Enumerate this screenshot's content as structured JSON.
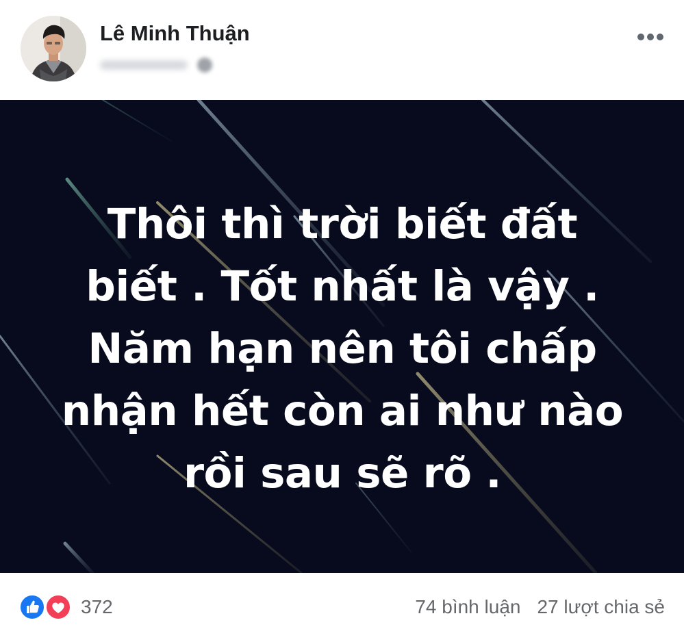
{
  "post": {
    "author": "Lê Minh Thuận",
    "meta_timestamp": "",
    "quote": "Thôi thì trời biết đất\nbiết . Tốt nhất là vậy .\nNăm hạn nên tôi chấp\nnhận hết còn ai như nào\nrồi sau sẽ rõ ."
  },
  "reactions": {
    "icons": [
      "like-icon",
      "love-icon"
    ],
    "count": "372"
  },
  "stats": {
    "comments": "74 bình luận",
    "shares": "27 lượt chia sẻ"
  },
  "colors": {
    "image_background": "#070b1d",
    "like": "#1877f2",
    "love": "#f33e58",
    "secondary_text": "#65676b",
    "name_text": "#1c1e21"
  },
  "icons": {
    "more": "more-horizontal-icon",
    "privacy": "globe-icon"
  }
}
